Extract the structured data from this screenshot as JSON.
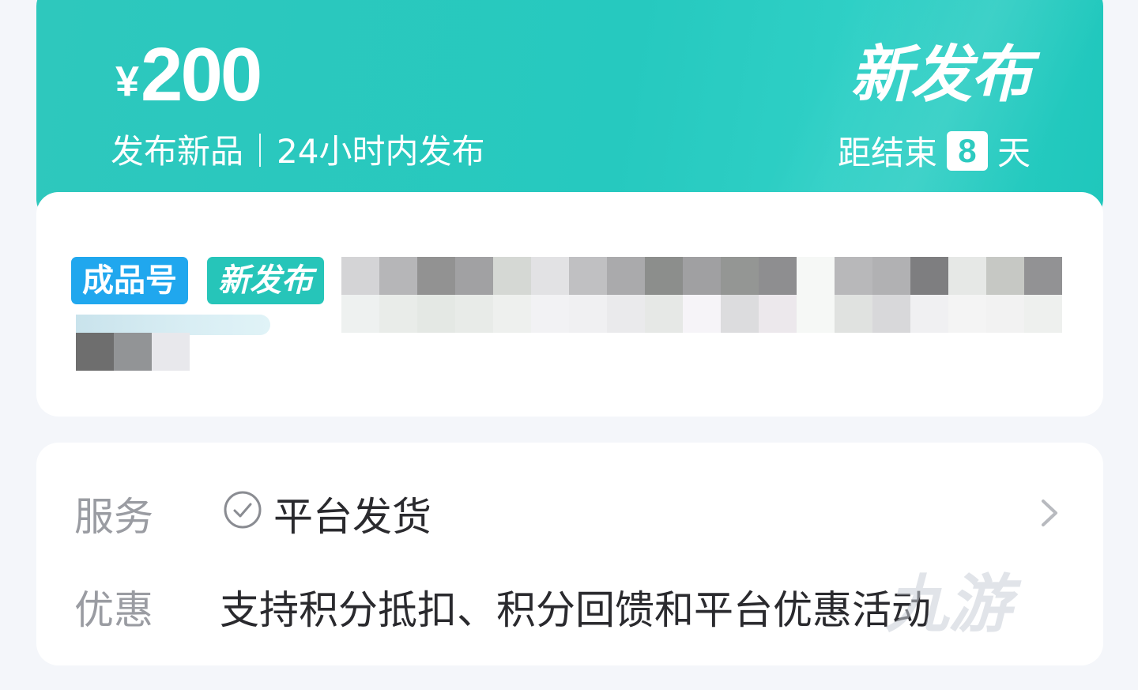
{
  "banner": {
    "currency": "¥",
    "price": "200",
    "subtitle": "发布新品｜24小时内发布",
    "badge": "新发布",
    "countdown_prefix": "距结束",
    "countdown_days": "8",
    "countdown_suffix": "天",
    "accent_color": "#26c9bf"
  },
  "product": {
    "tags": [
      "成品号",
      "新发布"
    ],
    "tag_colors": [
      "#20a7ee",
      "#26c5b9"
    ]
  },
  "service": {
    "service_label": "服务",
    "service_value": "平台发货",
    "service_icon": "check-circle-icon",
    "discount_label": "优惠",
    "discount_value": "支持积分抵扣、积分回馈和平台优惠活动"
  },
  "watermark": "九游"
}
